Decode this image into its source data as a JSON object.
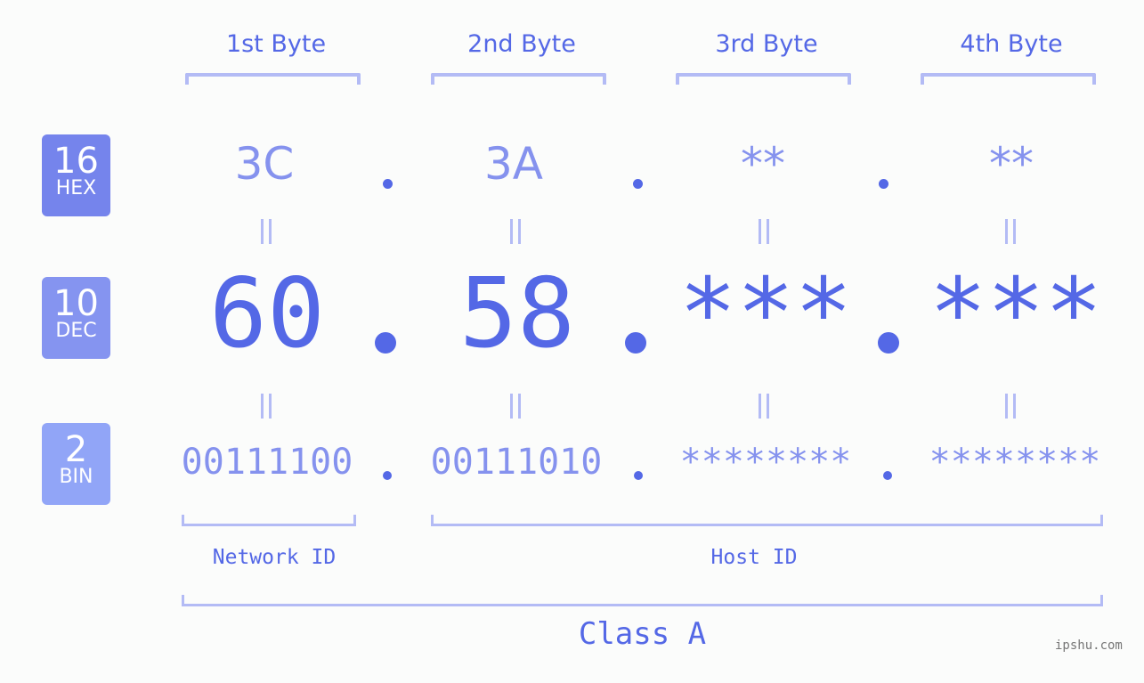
{
  "bytes": [
    {
      "title": "1st Byte",
      "hex": "3C",
      "dec": "60",
      "bin": "00111100"
    },
    {
      "title": "2nd Byte",
      "hex": "3A",
      "dec": "58",
      "bin": "00111010"
    },
    {
      "title": "3rd Byte",
      "hex": "**",
      "dec": "***",
      "bin": "********"
    },
    {
      "title": "4th Byte",
      "hex": "**",
      "dec": "***",
      "bin": "********"
    }
  ],
  "badges": {
    "hex": {
      "num": "16",
      "label": "HEX",
      "color": "#7584ec"
    },
    "dec": {
      "num": "10",
      "label": "DEC",
      "color": "#8594f0"
    },
    "bin": {
      "num": "2",
      "label": "BIN",
      "color": "#91a5f7"
    }
  },
  "equals_symbol": "=",
  "segments": {
    "network": "Network ID",
    "host": "Host ID"
  },
  "class_label": "Class A",
  "watermark": "ipshu.com",
  "colors": {
    "primary": "#5468e6",
    "light": "#8592ee",
    "bracket": "#b3bbf5",
    "background": "#fbfcfb"
  }
}
